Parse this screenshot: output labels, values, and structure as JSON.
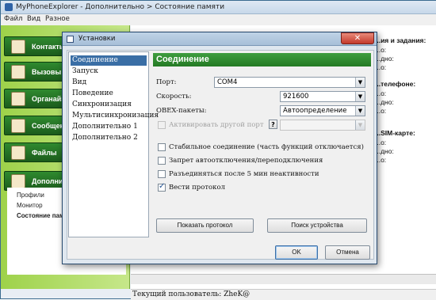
{
  "main": {
    "title": "MyPhoneExplorer  -  Дополнительно > Состояние памяти",
    "menu": [
      "Файл",
      "Вид",
      "Разное"
    ],
    "nav": [
      {
        "label": "Контакты",
        "icon": "contacts-icon"
      },
      {
        "label": "Вызовы",
        "icon": "calls-icon"
      },
      {
        "label": "Органайзер",
        "icon": "organizer-icon"
      },
      {
        "label": "Сообщения",
        "icon": "messages-icon"
      },
      {
        "label": "Файлы",
        "icon": "files-icon"
      },
      {
        "label": "Дополнительно",
        "icon": "tools-icon"
      }
    ],
    "subnav": [
      "Профили",
      "Монитор",
      "Состояние памяти"
    ],
    "right_lines": [
      "...ия и задания:",
      "...о:",
      "...дно:",
      "...о:",
      "...телефоне:",
      "...о:",
      "...дно:",
      "...о:",
      "...SIM-карте:",
      "...о:",
      "...дно:",
      "...о:"
    ],
    "status": "Текущий пользователь: ZheK@"
  },
  "dialog": {
    "title": "Установки",
    "close": "✕",
    "categories": [
      "Соединение",
      "Запуск",
      "Вид",
      "Поведение",
      "Синхронизация",
      "Мультисинхронизация",
      "Дополнительно 1",
      "Дополнительно 2"
    ],
    "selected_category": "Соединение",
    "panel_title": "Соединение",
    "port_label": "Порт:",
    "port_value": "COM4",
    "speed_label": "Скорость:",
    "speed_value": "921600",
    "obex_label": "OBEX-пакеты:",
    "obex_value": "Автоопределение",
    "other_port_label": "Активировать другой порт",
    "help": "?",
    "options": [
      {
        "label": "Стабильное соединение (часть функций отключается)",
        "checked": false
      },
      {
        "label": "Запрет автоотключения/переподключения",
        "checked": false
      },
      {
        "label": "Разъединяться после 5 мин неактивности",
        "checked": false
      },
      {
        "label": "Вести протокол",
        "checked": true
      }
    ],
    "show_log": "Показать протокол",
    "find_device": "Поиск устройства",
    "ok": "OK",
    "cancel": "Отмена"
  }
}
